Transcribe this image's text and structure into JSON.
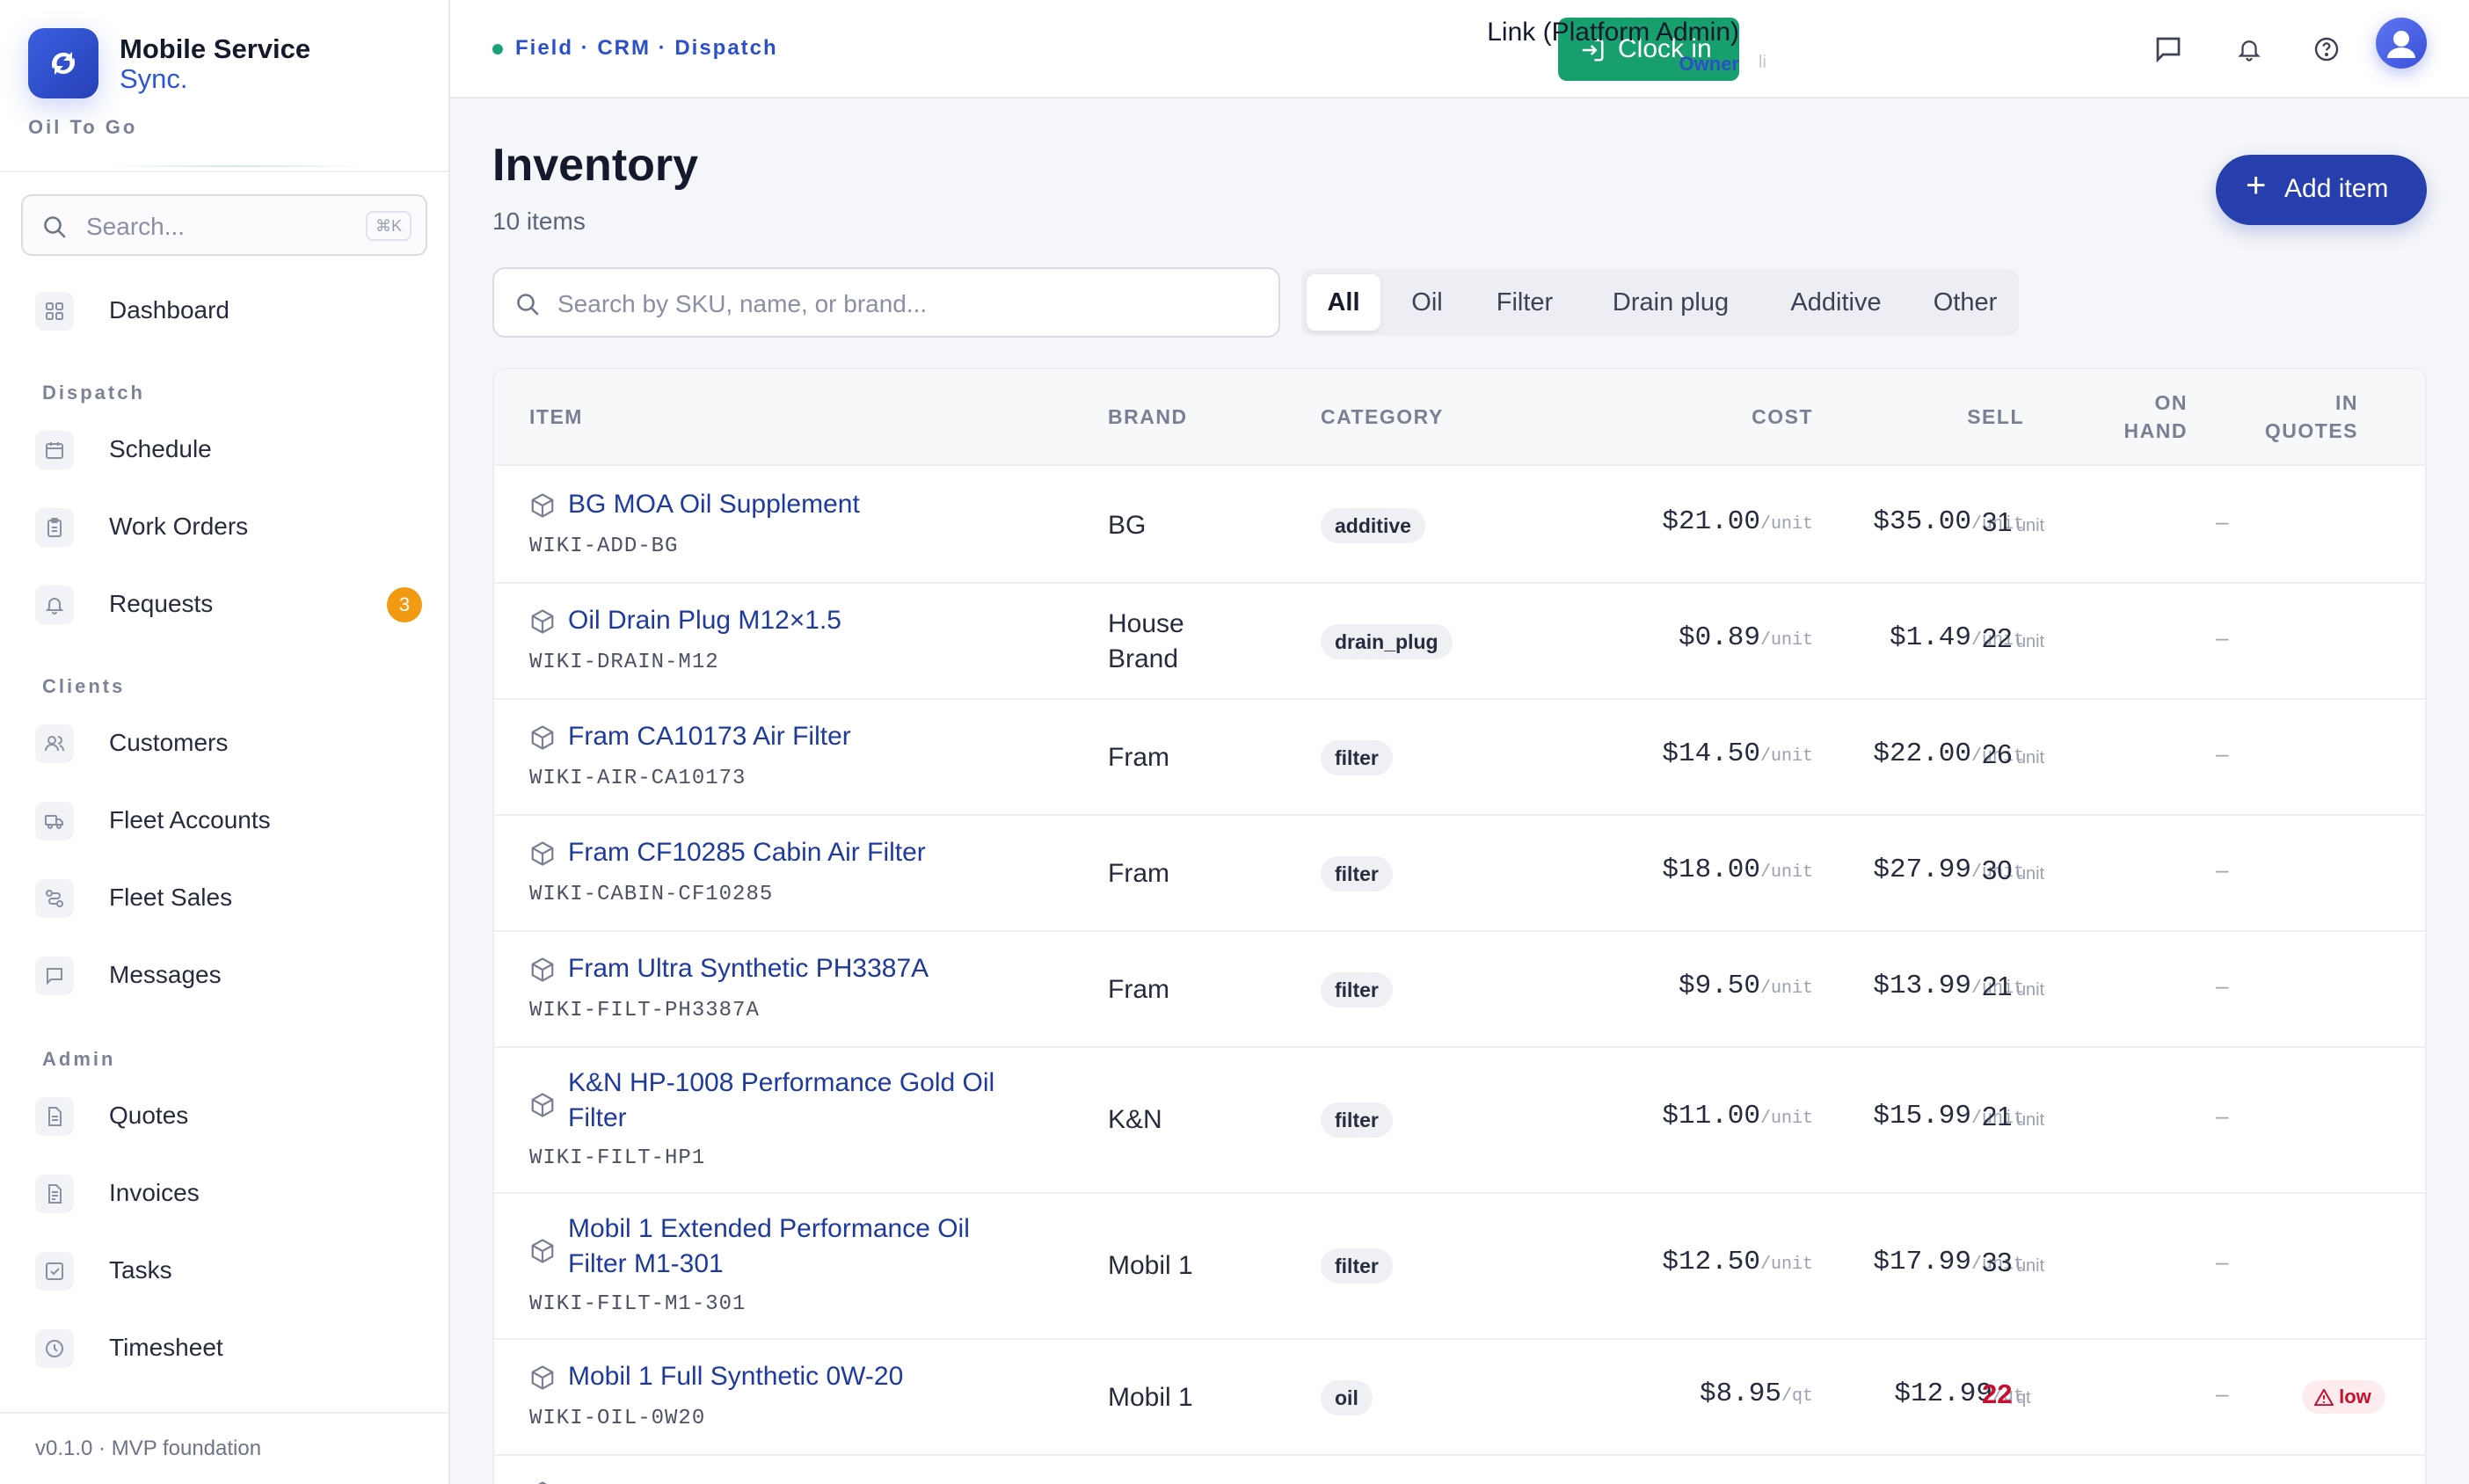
{
  "sidebar": {
    "brand_name": "Mobile Service",
    "brand_sub": "Sync.",
    "org": "Oil To Go",
    "search_placeholder": "Search...",
    "search_shortcut": "⌘K",
    "sections": {
      "dispatch": "Dispatch",
      "clients": "Clients",
      "admin": "Admin"
    },
    "items": {
      "dashboard": "Dashboard",
      "schedule": "Schedule",
      "work_orders": "Work Orders",
      "requests": "Requests",
      "requests_badge": "3",
      "customers": "Customers",
      "fleet_accounts": "Fleet Accounts",
      "fleet_sales": "Fleet Sales",
      "messages": "Messages",
      "quotes": "Quotes",
      "invoices": "Invoices",
      "tasks": "Tasks",
      "timesheet": "Timesheet"
    },
    "footer": "v0.1.0 · MVP foundation"
  },
  "topbar": {
    "breadcrumb": "Field · CRM · Dispatch",
    "clock_in": "Clock in",
    "tick": "li",
    "user_name": "Link (Platform Admin)",
    "user_role": "Owner"
  },
  "main": {
    "title": "Inventory",
    "count": "10 items",
    "add_item": "Add item",
    "search_placeholder": "Search by SKU, name, or brand...",
    "filters": [
      "All",
      "Oil",
      "Filter",
      "Drain plug",
      "Additive",
      "Other"
    ],
    "active_filter": "All"
  },
  "table": {
    "headers": {
      "item": "ITEM",
      "brand": "BRAND",
      "category": "CATEGORY",
      "cost": "COST",
      "sell": "SELL",
      "on_hand_1": "ON",
      "on_hand_2": "HAND",
      "in_quotes_1": "IN",
      "in_quotes_2": "QUOTES"
    },
    "rows": [
      {
        "name": "BG MOA Oil Supplement",
        "sku": "WIKI-ADD-BG",
        "brand": "BG",
        "category": "additive",
        "cost": "$21.00",
        "cost_unit": "/unit",
        "sell": "$35.00",
        "sell_unit": "/unit",
        "on_hand": "31",
        "on_hand_unit": "unit",
        "in_quotes": "–"
      },
      {
        "name": "Oil Drain Plug M12×1.5",
        "sku": "WIKI-DRAIN-M12",
        "brand": "House Brand",
        "category": "drain_plug",
        "cost": "$0.89",
        "cost_unit": "/unit",
        "sell": "$1.49",
        "sell_unit": "/unit",
        "on_hand": "22",
        "on_hand_unit": "unit",
        "in_quotes": "–"
      },
      {
        "name": "Fram CA10173 Air Filter",
        "sku": "WIKI-AIR-CA10173",
        "brand": "Fram",
        "category": "filter",
        "cost": "$14.50",
        "cost_unit": "/unit",
        "sell": "$22.00",
        "sell_unit": "/unit",
        "on_hand": "26",
        "on_hand_unit": "unit",
        "in_quotes": "–"
      },
      {
        "name": "Fram CF10285 Cabin Air Filter",
        "sku": "WIKI-CABIN-CF10285",
        "brand": "Fram",
        "category": "filter",
        "cost": "$18.00",
        "cost_unit": "/unit",
        "sell": "$27.99",
        "sell_unit": "/unit",
        "on_hand": "30",
        "on_hand_unit": "unit",
        "in_quotes": "–"
      },
      {
        "name": "Fram Ultra Synthetic PH3387A",
        "sku": "WIKI-FILT-PH3387A",
        "brand": "Fram",
        "category": "filter",
        "cost": "$9.50",
        "cost_unit": "/unit",
        "sell": "$13.99",
        "sell_unit": "/unit",
        "on_hand": "21",
        "on_hand_unit": "unit",
        "in_quotes": "–"
      },
      {
        "name": "K&N HP-1008 Performance Gold Oil Filter",
        "sku": "WIKI-FILT-HP1",
        "brand": "K&N",
        "category": "filter",
        "cost": "$11.00",
        "cost_unit": "/unit",
        "sell": "$15.99",
        "sell_unit": "/unit",
        "on_hand": "21",
        "on_hand_unit": "unit",
        "in_quotes": "–"
      },
      {
        "name": "Mobil 1 Extended Performance Oil Filter M1-301",
        "sku": "WIKI-FILT-M1-301",
        "brand": "Mobil 1",
        "category": "filter",
        "cost": "$12.50",
        "cost_unit": "/unit",
        "sell": "$17.99",
        "sell_unit": "/unit",
        "on_hand": "33",
        "on_hand_unit": "unit",
        "in_quotes": "–"
      },
      {
        "name": "Mobil 1 Full Synthetic 0W-20",
        "sku": "WIKI-OIL-0W20",
        "brand": "Mobil 1",
        "category": "oil",
        "cost": "$8.95",
        "cost_unit": "/qt",
        "sell": "$12.99",
        "sell_unit": "/qt",
        "on_hand": "22",
        "on_hand_unit": "qt",
        "in_quotes": "–",
        "low": "low"
      }
    ]
  },
  "colors": {
    "accent": "#263fad",
    "link": "#1f3a9e",
    "clock_in": "#17a06e",
    "badge": "#f29a12",
    "low": "#c8102e"
  }
}
